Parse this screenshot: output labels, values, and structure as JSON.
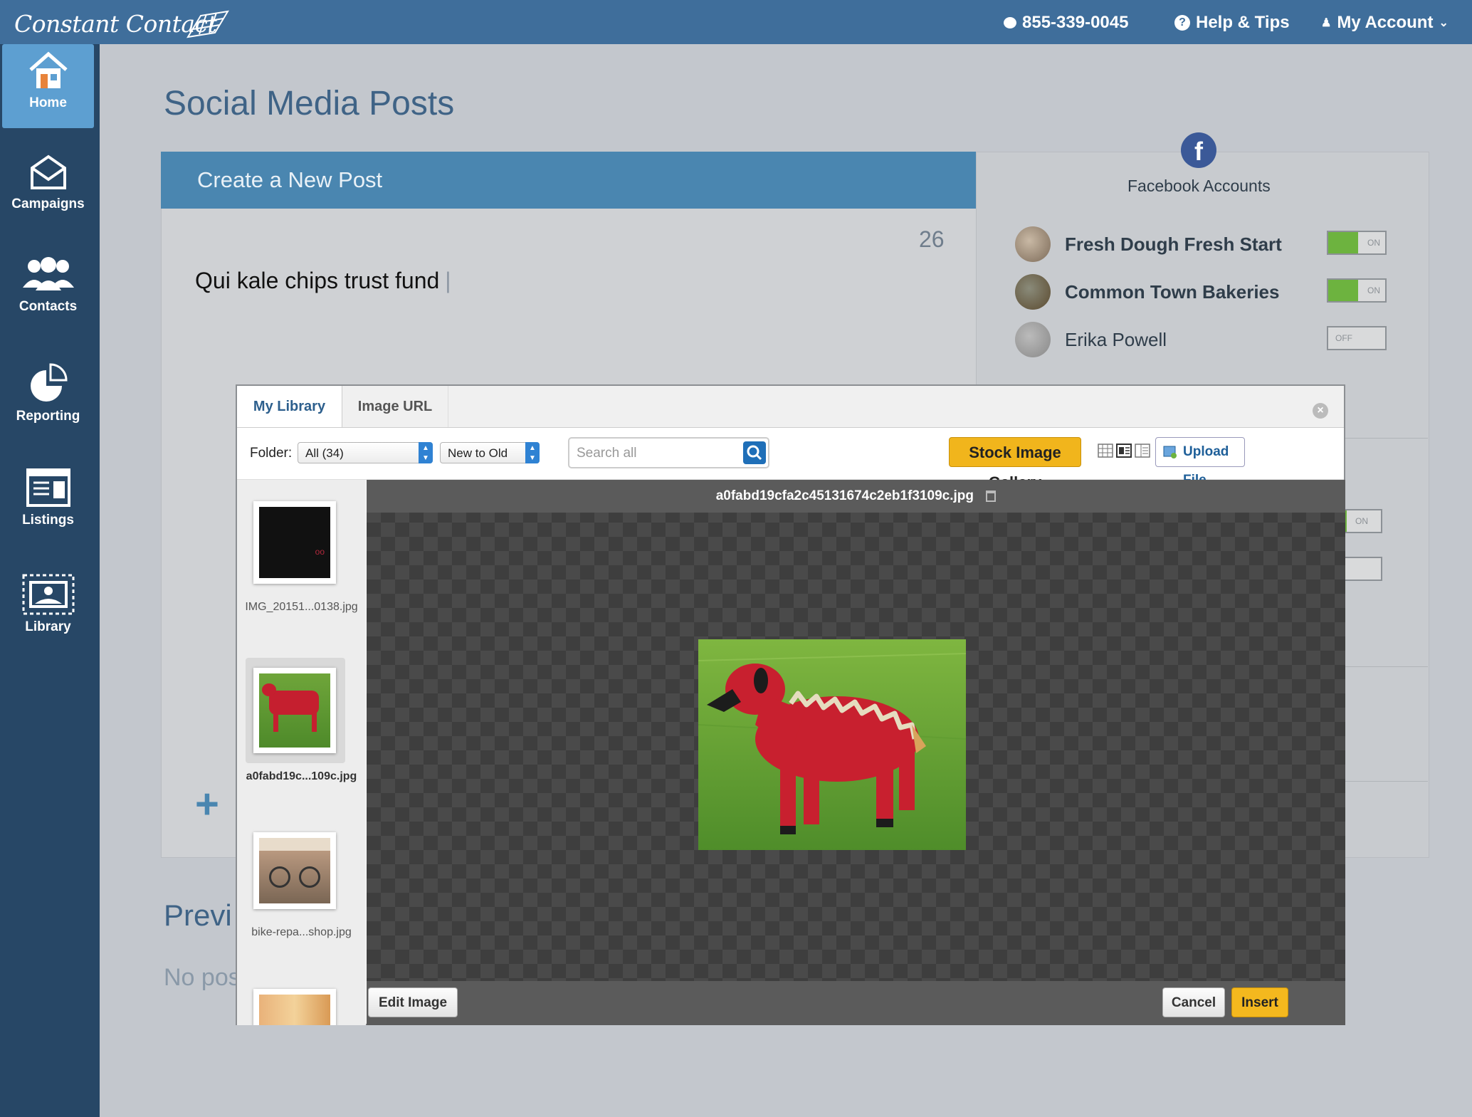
{
  "topbar": {
    "logo": "Constant Contact",
    "phone": "855-339-0045",
    "help": "Help & Tips",
    "account": "My Account"
  },
  "sidebar": {
    "items": [
      {
        "label": "Home"
      },
      {
        "label": "Campaigns"
      },
      {
        "label": "Contacts"
      },
      {
        "label": "Reporting"
      },
      {
        "label": "Listings"
      },
      {
        "label": "Library"
      }
    ]
  },
  "page": {
    "title": "Social Media Posts",
    "create_header": "Create a New Post",
    "char_count": "26",
    "post_text": "Qui kale chips trust fund",
    "previous_title": "Previ",
    "no_posts": "No pos"
  },
  "facebook": {
    "title": "Facebook Accounts",
    "accounts": [
      {
        "name": "Fresh Dough Fresh Start",
        "state": "ON"
      },
      {
        "name": "Common Town Bakeries",
        "state": "ON"
      },
      {
        "name": "Erika Powell",
        "state": "OFF"
      }
    ],
    "behind_toggle": "ON"
  },
  "modal": {
    "tabs": [
      "My Library",
      "Image URL"
    ],
    "folder_label": "Folder:",
    "folder_value": "All (34)",
    "sort_value": "New to Old",
    "search_placeholder": "Search all",
    "stock_button": "Stock Image Gallery",
    "upload_button": "Upload File",
    "thumbnails": [
      {
        "caption": "IMG_20151...0138.jpg"
      },
      {
        "caption": "a0fabd19c...109c.jpg"
      },
      {
        "caption": "bike-repa...shop.jpg"
      }
    ],
    "selected_filename": "a0fabd19cfa2c45131674c2eb1f3109c.jpg",
    "edit_button": "Edit Image",
    "cancel_button": "Cancel",
    "insert_button": "Insert"
  },
  "colors": {
    "topbar": "#3f6e9b",
    "sidebar": "#274766",
    "accent_yellow": "#f1b51c",
    "toggle_on": "#6db33f",
    "facebook": "#3b5998"
  }
}
